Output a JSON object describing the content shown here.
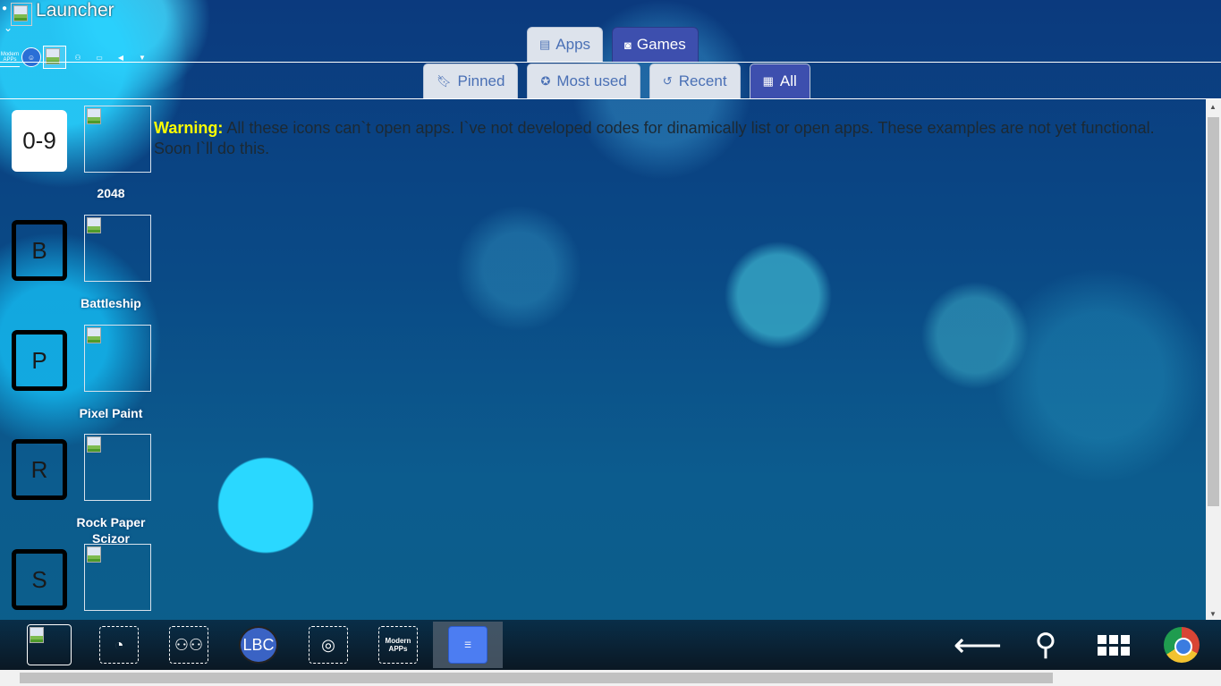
{
  "window": {
    "title": "Launcher"
  },
  "top_tabs": [
    {
      "label": "Apps",
      "icon": "card-icon",
      "active": false
    },
    {
      "label": "Games",
      "icon": "gamepad-icon",
      "active": true
    }
  ],
  "sub_tabs": [
    {
      "label": "Pinned",
      "icon": "bookmark-icon",
      "active": false
    },
    {
      "label": "Most used",
      "icon": "star-circle-icon",
      "active": false
    },
    {
      "label": "Recent",
      "icon": "history-icon",
      "active": false
    },
    {
      "label": "All",
      "icon": "grid-icon",
      "active": true
    }
  ],
  "warning": {
    "prefix": "Warning:",
    "text": " All these icons can`t open apps. I`ve not developed codes for dinamically list or open apps. These examples are not yet functional. Soon I`ll do this."
  },
  "groups": [
    {
      "letter": "0-9",
      "app": "2048"
    },
    {
      "letter": "B",
      "app": "Battleship"
    },
    {
      "letter": "P",
      "app": "Pixel Paint"
    },
    {
      "letter": "R",
      "app": "Rock Paper Scizor"
    },
    {
      "letter": "S",
      "app": ""
    }
  ],
  "mini_toolbar": {
    "modern_label": "Modern APPs"
  },
  "taskbar": {
    "modern_label": "Modern APPs",
    "ball_label": "LBC"
  },
  "colors": {
    "active_tab": "#3d4fae",
    "inactive_tab": "#dde3ec",
    "warning": "#ffff00"
  }
}
